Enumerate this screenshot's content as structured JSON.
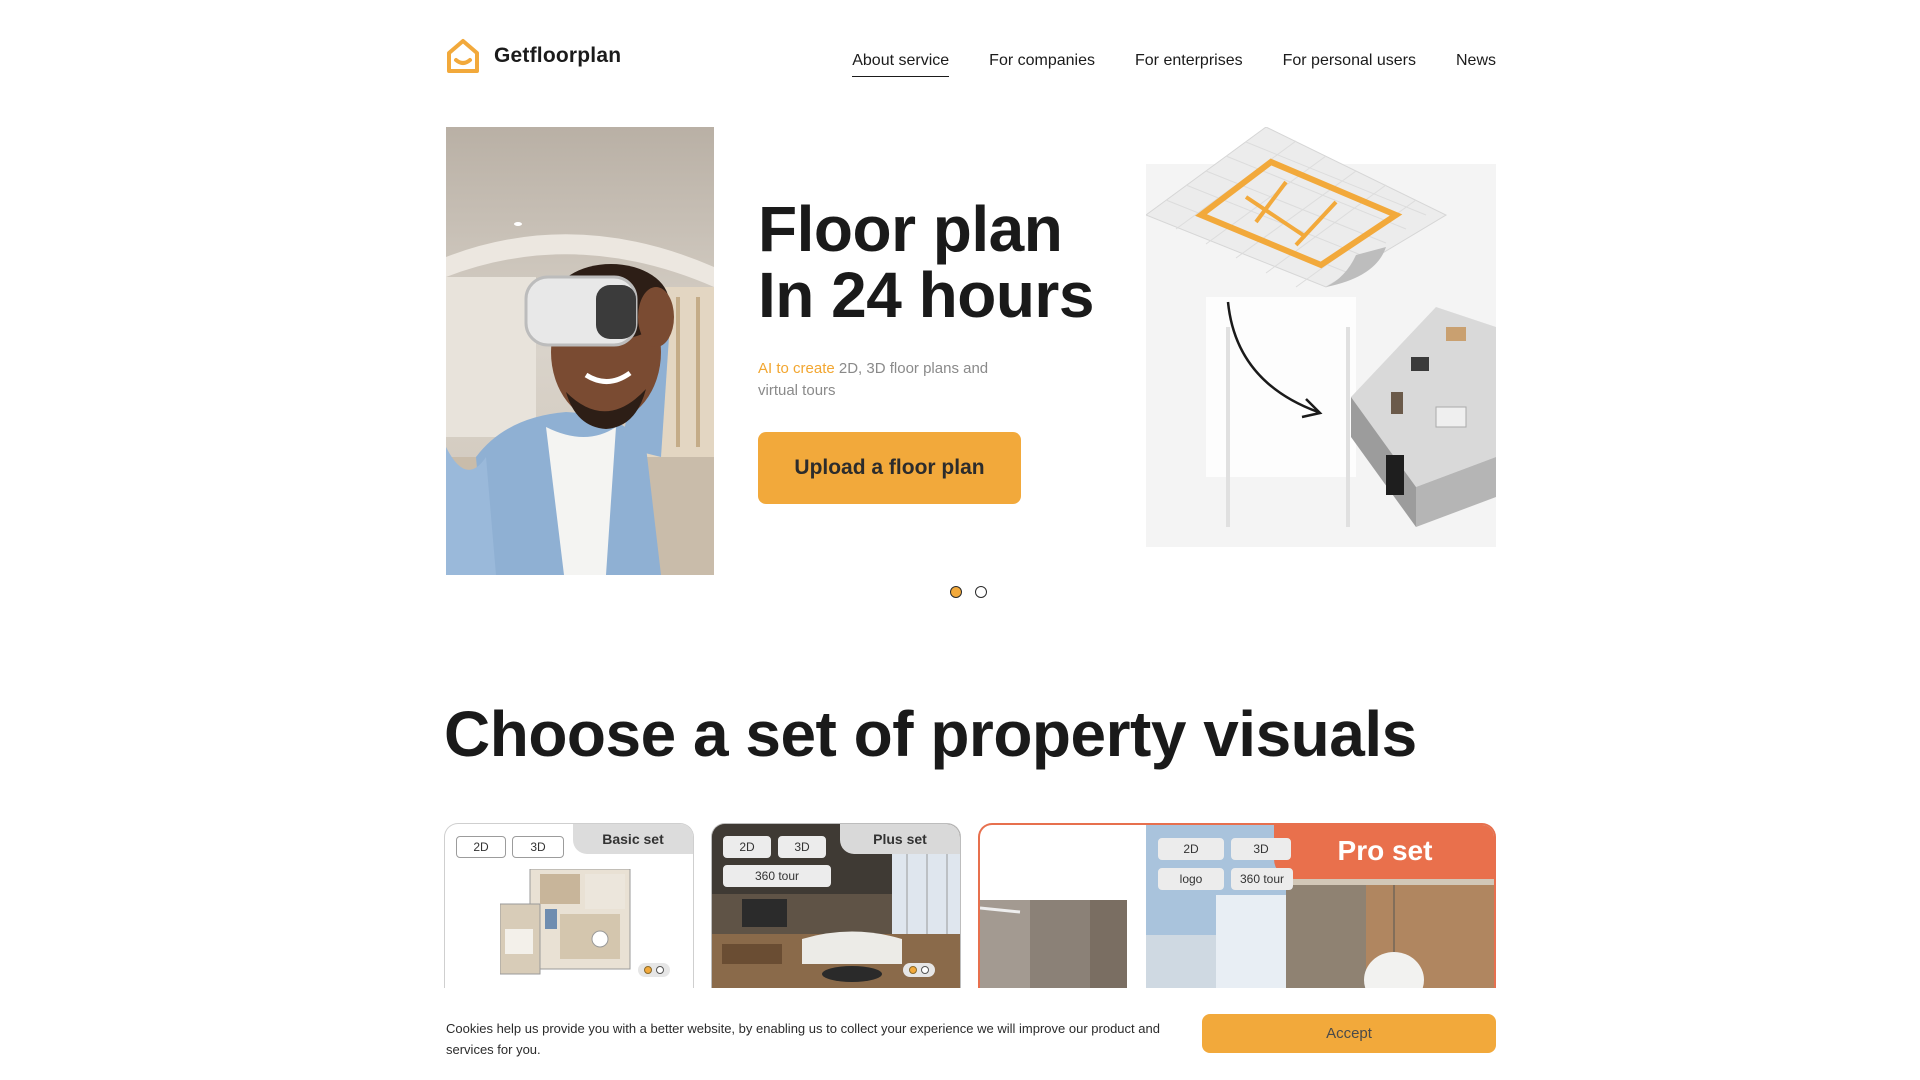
{
  "brand": {
    "name": "Getfloorplan",
    "accent_color": "#f2a93b",
    "pro_color": "#e9704c"
  },
  "nav": {
    "items": [
      "About service",
      "For companies",
      "For enterprises",
      "For personal users",
      "News"
    ],
    "active_index": 0
  },
  "hero": {
    "title_line1": "Floor plan",
    "title_line2": "In 24 hours",
    "subtitle_highlight": "AI to create",
    "subtitle_rest": " 2D, 3D floor plans and virtual tours",
    "cta_label": "Upload a floor plan",
    "slides_total": 2,
    "slide_active": 1
  },
  "sets": {
    "title": "Choose a set of property visuals",
    "basic": {
      "label": "Basic set",
      "chips": [
        "2D",
        "3D"
      ]
    },
    "plus": {
      "label": "Plus set",
      "chips": [
        "2D",
        "3D",
        "360 tour"
      ]
    },
    "pro": {
      "label": "Pro set",
      "chips": [
        "2D",
        "3D",
        "logo",
        "360 tour"
      ]
    }
  },
  "cookie": {
    "text": "Cookies help us provide you with a better website, by enabling us to collect your experience we will improve our product and services for you.",
    "accept_label": "Accept"
  },
  "icons": [
    "house-logo-icon",
    "curved-arrow-icon"
  ]
}
